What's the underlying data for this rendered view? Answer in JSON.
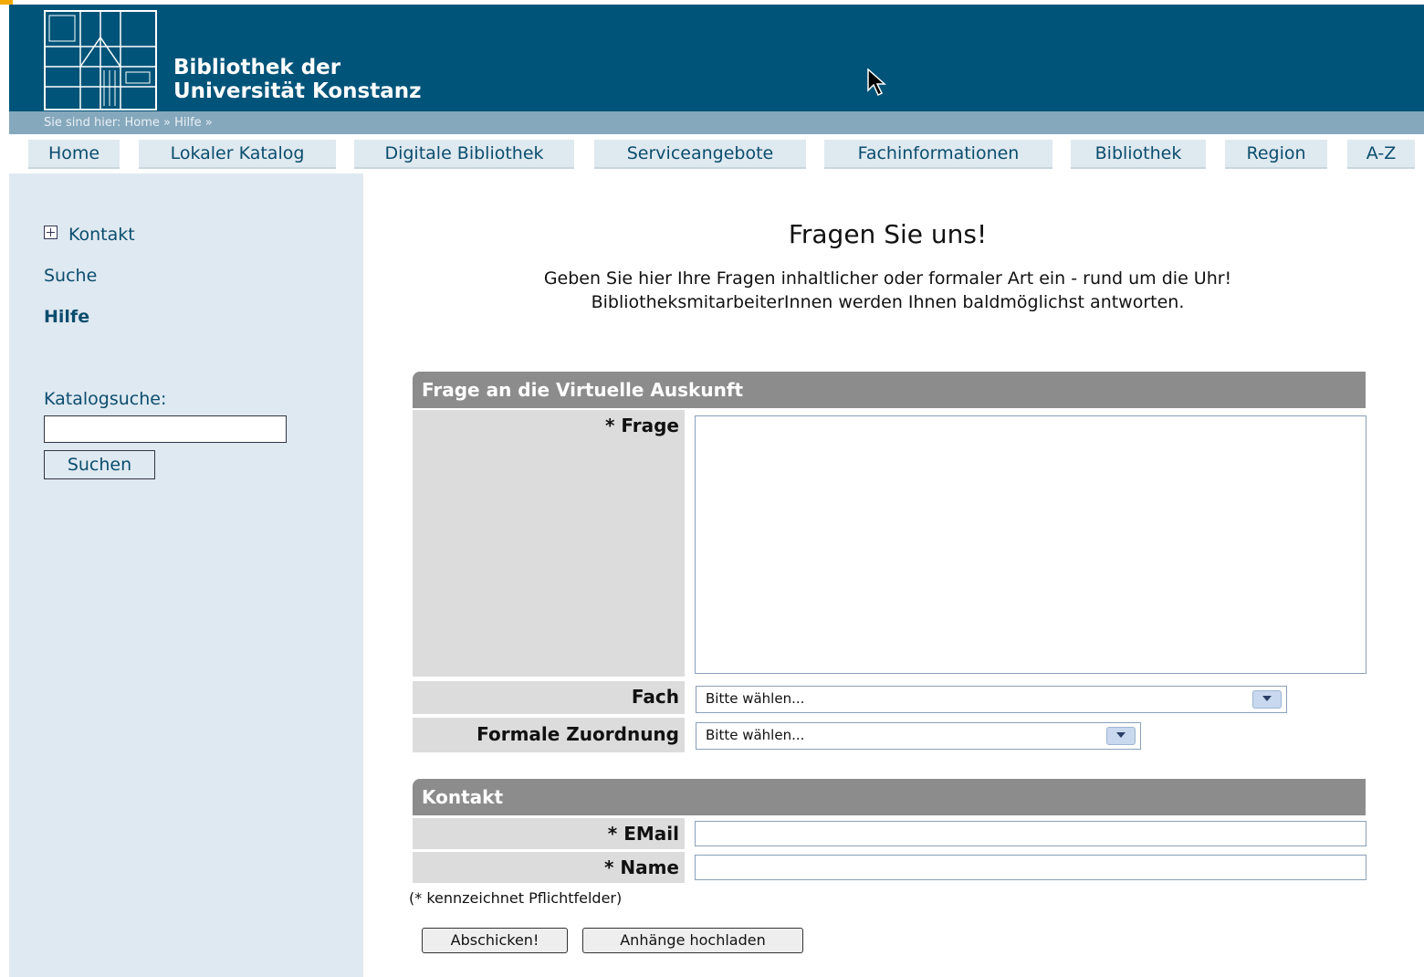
{
  "colors": {
    "header_bg": "#005479",
    "breadcrumb_bg": "#86a8bd",
    "sidebar_bg": "#dfe9f1",
    "panel_head_bg": "#8c8c8c",
    "label_bg": "#dcdcdc"
  },
  "header": {
    "line1": "Bibliothek der",
    "line2": "Universität Konstanz",
    "logo": "university-logo-icon"
  },
  "breadcrumb": "Sie sind hier: Home » Hilfe »",
  "nav": {
    "tabs": [
      "Home",
      "Lokaler Katalog",
      "Digitale Bibliothek",
      "Serviceangebote",
      "Fachinformationen",
      "Bibliothek",
      "Region",
      "A-Z"
    ]
  },
  "sidebar": {
    "kontakt": "Kontakt",
    "suche": "Suche",
    "hilfe": "Hilfe",
    "katalog_label": "Katalogsuche:",
    "katalog_value": "",
    "suchen_button": "Suchen"
  },
  "main": {
    "title": "Fragen Sie uns!",
    "intro_line1": "Geben Sie hier Ihre Fragen inhaltlicher oder formaler Art ein - rund um die Uhr!",
    "intro_line2": "BibliotheksmitarbeiterInnen werden Ihnen baldmöglichst antworten."
  },
  "form": {
    "section1_title": "Frage an die Virtuelle Auskunft",
    "frage_label": "* Frage",
    "frage_value": "",
    "fach_label": "Fach",
    "fach_value": "Bitte wählen...",
    "zuordnung_label": "Formale Zuordnung",
    "zuordnung_value": "Bitte wählen...",
    "section2_title": "Kontakt",
    "email_label": "* EMail",
    "email_value": "",
    "name_label": "* Name",
    "name_value": "",
    "required_note": "(* kennzeichnet Pflichtfelder)",
    "submit_button": "Abschicken!",
    "upload_button": "Anhänge hochladen"
  }
}
